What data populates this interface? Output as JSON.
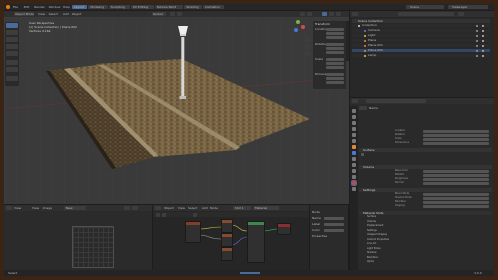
{
  "topbar": {
    "menus": [
      "File",
      "Edit",
      "Render",
      "Window",
      "Help"
    ],
    "workspace_tabs": [
      "Layout",
      "Modeling",
      "Sculpting",
      "UV Editing",
      "Texture Paint",
      "Shading",
      "Animation"
    ],
    "scene": "Scene",
    "view_layer": "ViewLayer"
  },
  "viewport": {
    "mode": "Object Mode",
    "menus": [
      "View",
      "Select",
      "Add",
      "Object"
    ],
    "orientation": "Global",
    "overlay_title": "User Perspective",
    "overlay_subtitle": "(1) Scene Collection | Plane.002",
    "overlay_stat": "Vertices 4,164",
    "tools": [
      "cursor",
      "move",
      "rotate",
      "scale",
      "transform",
      "annotate",
      "measure",
      "add"
    ]
  },
  "item_panel": {
    "title": "Transform",
    "rows": [
      "Location",
      "Rotation",
      "Scale",
      "Dimensions"
    ]
  },
  "outliner": {
    "title": "Scene Collection",
    "items": [
      "Collection",
      "Camera",
      "Light",
      "Plane",
      "Plane.001",
      "Plane.002",
      "Lamp"
    ]
  },
  "properties": {
    "tabs": [
      "tool",
      "render",
      "output",
      "view",
      "scene",
      "world",
      "object",
      "modifiers",
      "particles",
      "physics",
      "constraints",
      "data",
      "material",
      "texture"
    ],
    "name_label": "Name",
    "rows_a": [
      "Location",
      "Rotation",
      "Scale",
      "Dimensions"
    ],
    "section_a": "Surface",
    "section_b": "Volume",
    "section_c": "Settings",
    "rows_b": [
      "Base Color",
      "Metallic",
      "Roughness",
      "Normal"
    ],
    "rows_c": [
      "Blend Mode",
      "Shadow Mode",
      "Backface",
      "Clipping"
    ],
    "list_title": "Material Slots",
    "list_items": [
      "Surface",
      "Volume",
      "Displacement",
      "Settings",
      "Viewport Display",
      "Custom Properties",
      "Line Art",
      "Light Probe",
      "Shadow",
      "Backface",
      "Alpha",
      "Blend"
    ]
  },
  "image_editor": {
    "mode": "View",
    "menus": [
      "View",
      "Image"
    ],
    "image_name": "New"
  },
  "node_editor": {
    "menus": [
      "Object",
      "View",
      "Select",
      "Add",
      "Node"
    ],
    "slot": "Slot 1",
    "material": "Material",
    "side_panel": [
      "Node",
      "Name",
      "Label",
      "Color",
      "Properties"
    ]
  },
  "statusbar": {
    "left": "Select",
    "right": "3.0.0"
  }
}
